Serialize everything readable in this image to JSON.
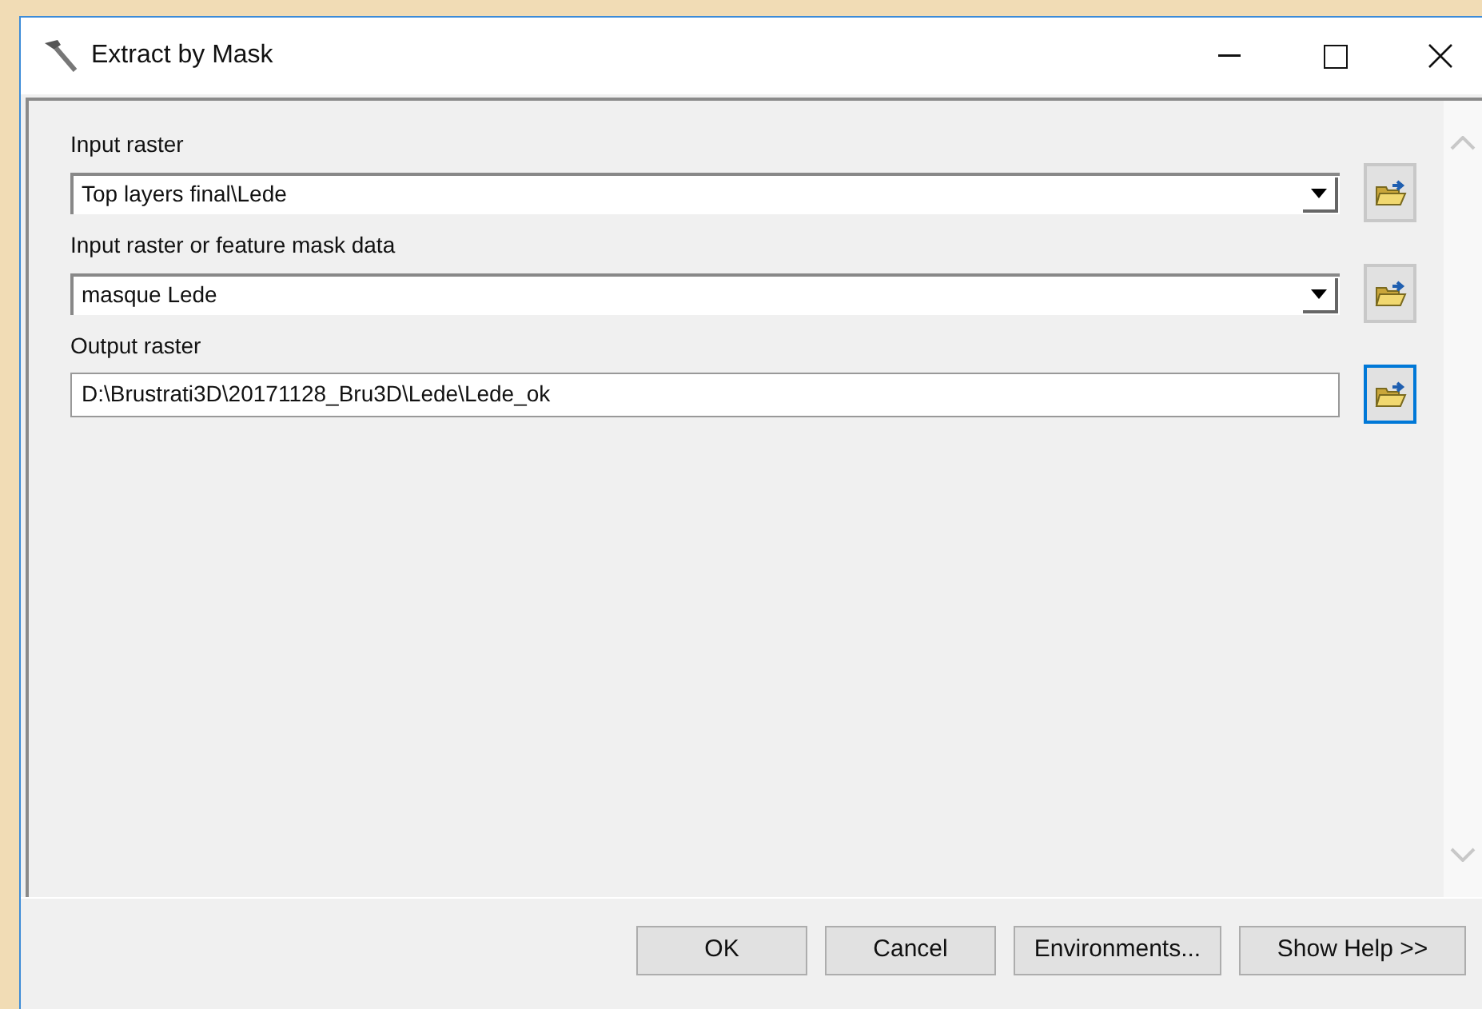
{
  "window": {
    "title": "Extract by Mask"
  },
  "fields": [
    {
      "label": "Input raster",
      "kind": "combo",
      "value": "Top layers final\\Lede",
      "browse_focused": false
    },
    {
      "label": "Input raster or feature mask data",
      "kind": "combo",
      "value": "masque Lede",
      "browse_focused": false
    },
    {
      "label": "Output raster",
      "kind": "text",
      "value": "D:\\Brustrati3D\\20171128_Bru3D\\Lede\\Lede_ok",
      "browse_focused": true
    }
  ],
  "buttons": [
    "OK",
    "Cancel",
    "Environments...",
    "Show Help >>"
  ]
}
